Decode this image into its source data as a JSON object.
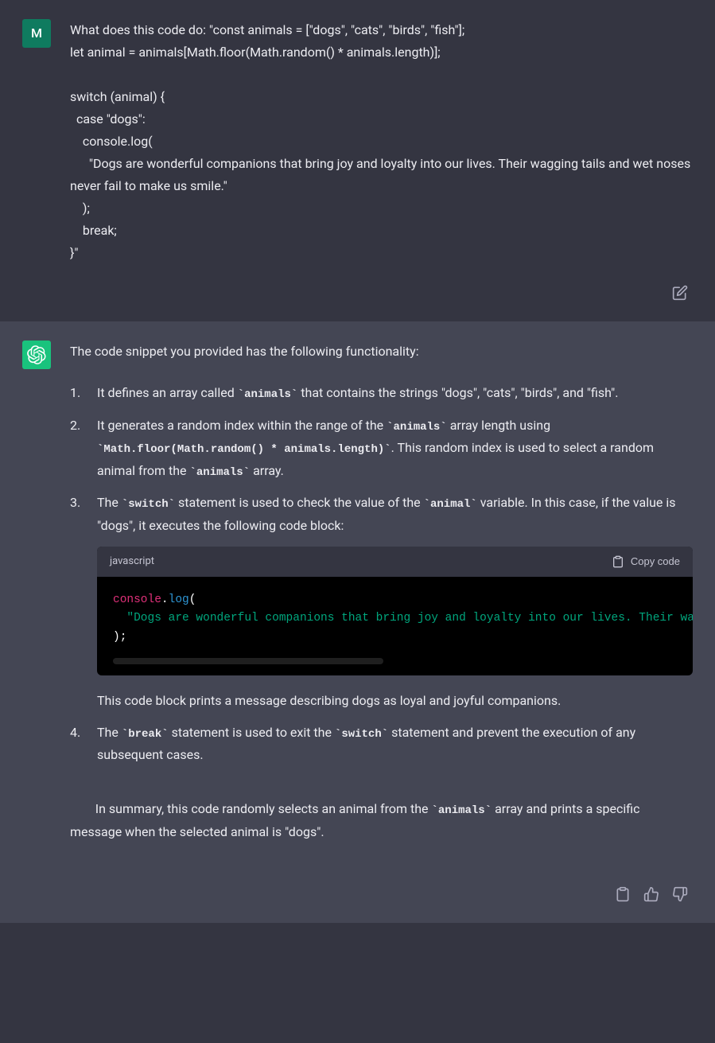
{
  "user": {
    "avatar_letter": "M",
    "message_text": "What does this code do: \"const animals = [\"dogs\", \"cats\", \"birds\", \"fish\"];\nlet animal = animals[Math.floor(Math.random() * animals.length)];\n\nswitch (animal) {\n  case \"dogs\":\n    console.log(\n      \"Dogs are wonderful companions that bring joy and loyalty into our lives. Their wagging tails and wet noses never fail to make us smile.\"\n    );\n    break;\n}\""
  },
  "assistant": {
    "intro": "The code snippet you provided has the following functionality:",
    "items": {
      "i1_a": "It defines an array called ",
      "i1_code1": "`animals`",
      "i1_b": " that contains the strings \"dogs\", \"cats\", \"birds\", and \"fish\".",
      "i2_a": "It generates a random index within the range of the ",
      "i2_code1": "`animals`",
      "i2_b": " array length using ",
      "i2_code2": "`Math.floor(Math.random() * animals.length)`",
      "i2_c": ". This random index is used to select a random animal from the ",
      "i2_code3": "`animals`",
      "i2_d": " array.",
      "i3_a": "The ",
      "i3_code1": "`switch`",
      "i3_b": " statement is used to check the value of the ",
      "i3_code2": "`animal`",
      "i3_c": " variable. In this case, if the value is \"dogs\", it executes the following code block:",
      "i3_followup": "This code block prints a message describing dogs as loyal and joyful companions.",
      "i4_a": "The ",
      "i4_code1": "`break`",
      "i4_b": " statement is used to exit the ",
      "i4_code2": "`switch`",
      "i4_c": " statement and prevent the execution of any subsequent cases."
    },
    "code_block": {
      "language": "javascript",
      "copy_label": "Copy code",
      "line1_console": "console",
      "line1_dot": ".",
      "line1_log": "log",
      "line1_open": "(",
      "line2_string": "  \"Dogs are wonderful companions that bring joy and loyalty into our lives. Their wagging tails and wet noses never fail to make us smile.\"",
      "line3": ");"
    },
    "summary_a": "In summary, this code randomly selects an animal from the ",
    "summary_code": "`animals`",
    "summary_b": " array and prints a specific message when the selected animal is \"dogs\"."
  }
}
